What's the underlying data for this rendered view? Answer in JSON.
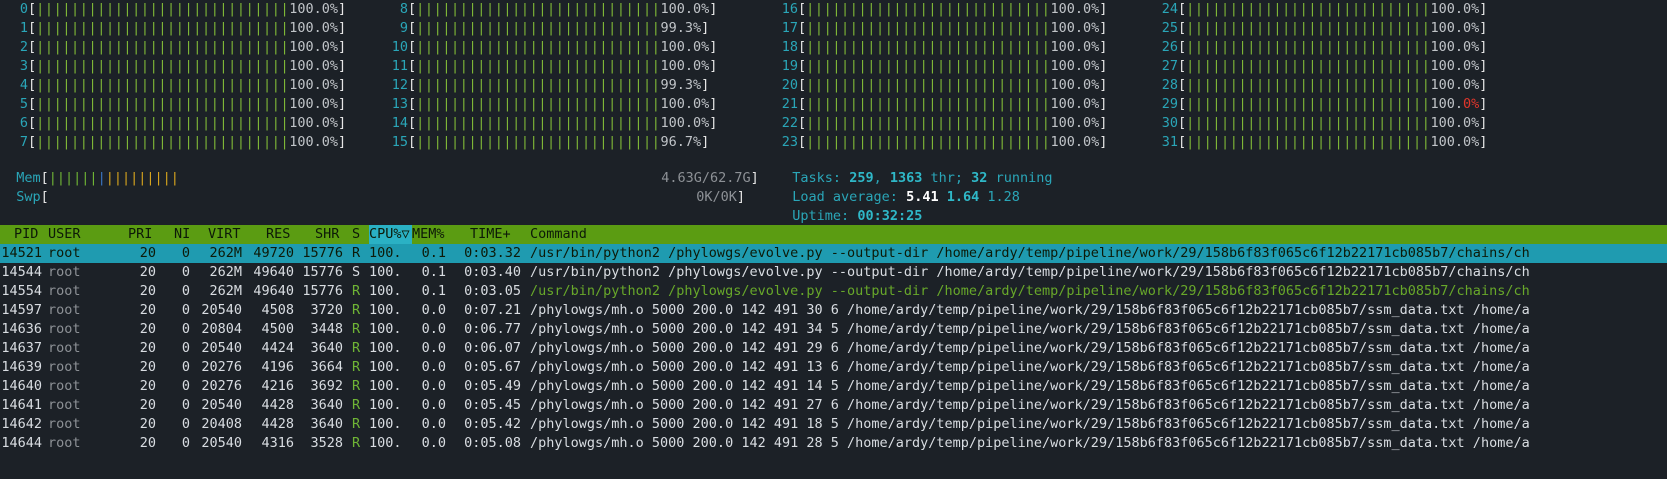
{
  "cpus": [
    {
      "id": "0",
      "bar": "|||||||||||||||||||||||||||||",
      "pct": "100.0%"
    },
    {
      "id": "1",
      "bar": "|||||||||||||||||||||||||||||",
      "pct": "100.0%"
    },
    {
      "id": "2",
      "bar": "|||||||||||||||||||||||||||||",
      "pct": "100.0%"
    },
    {
      "id": "3",
      "bar": "|||||||||||||||||||||||||||||",
      "pct": "100.0%"
    },
    {
      "id": "4",
      "bar": "|||||||||||||||||||||||||||||",
      "pct": "100.0%"
    },
    {
      "id": "5",
      "bar": "|||||||||||||||||||||||||||||",
      "pct": "100.0%"
    },
    {
      "id": "6",
      "bar": "|||||||||||||||||||||||||||||",
      "pct": "100.0%"
    },
    {
      "id": "7",
      "bar": "|||||||||||||||||||||||||||||",
      "pct": "100.0%"
    },
    {
      "id": "8",
      "bar": "||||||||||||||||||||||||||||",
      "pct": "100.0%"
    },
    {
      "id": "9",
      "bar": "||||||||||||||||||||||||||||",
      "pct": "99.3%"
    },
    {
      "id": "10",
      "bar": "||||||||||||||||||||||||||||",
      "pct": "100.0%"
    },
    {
      "id": "11",
      "bar": "||||||||||||||||||||||||||||",
      "pct": "100.0%"
    },
    {
      "id": "12",
      "bar": "||||||||||||||||||||||||||||",
      "pct": "99.3%"
    },
    {
      "id": "13",
      "bar": "||||||||||||||||||||||||||||",
      "pct": "100.0%"
    },
    {
      "id": "14",
      "bar": "||||||||||||||||||||||||||||",
      "pct": "100.0%"
    },
    {
      "id": "15",
      "bar": "||||||||||||||||||||||||||||",
      "pct": "96.7%"
    },
    {
      "id": "16",
      "bar": "||||||||||||||||||||||||||||",
      "pct": "100.0%"
    },
    {
      "id": "17",
      "bar": "||||||||||||||||||||||||||||",
      "pct": "100.0%"
    },
    {
      "id": "18",
      "bar": "||||||||||||||||||||||||||||",
      "pct": "100.0%"
    },
    {
      "id": "19",
      "bar": "||||||||||||||||||||||||||||",
      "pct": "100.0%"
    },
    {
      "id": "20",
      "bar": "||||||||||||||||||||||||||||",
      "pct": "100.0%"
    },
    {
      "id": "21",
      "bar": "||||||||||||||||||||||||||||",
      "pct": "100.0%"
    },
    {
      "id": "22",
      "bar": "||||||||||||||||||||||||||||",
      "pct": "100.0%"
    },
    {
      "id": "23",
      "bar": "||||||||||||||||||||||||||||",
      "pct": "100.0%"
    },
    {
      "id": "24",
      "bar": "||||||||||||||||||||||||||||",
      "pct": "100.0%"
    },
    {
      "id": "25",
      "bar": "||||||||||||||||||||||||||||",
      "pct": "100.0%"
    },
    {
      "id": "26",
      "bar": "||||||||||||||||||||||||||||",
      "pct": "100.0%"
    },
    {
      "id": "27",
      "bar": "||||||||||||||||||||||||||||",
      "pct": "100.0%"
    },
    {
      "id": "28",
      "bar": "||||||||||||||||||||||||||||",
      "pct": "100.0%"
    },
    {
      "id": "29",
      "bar": "||||||||||||||||||||||||||||",
      "pct": "100.0%"
    },
    {
      "id": "30",
      "bar": "||||||||||||||||||||||||||||",
      "pct": "100.0%"
    },
    {
      "id": "31",
      "bar": "||||||||||||||||||||||||||||",
      "pct": "100.0%"
    }
  ],
  "memory": {
    "mem_label": "Mem",
    "mem_bar_green": "||||||",
    "mem_bar_blue": "|",
    "mem_bar_yellow": "|||||||||",
    "mem_value": "4.63G/62.7G",
    "swp_label": "Swp",
    "swp_value": "0K/0K"
  },
  "info": {
    "tasks_label": "Tasks:",
    "tasks_count": "259",
    "tasks_sep1": ",",
    "threads_count": "1363",
    "threads_label": "thr;",
    "running_count": "32",
    "running_label": "running",
    "load_label": "Load average:",
    "load1": "5.41",
    "load5": "1.64",
    "load15": "1.28",
    "uptime_label": "Uptime:",
    "uptime_value": "00:32:25"
  },
  "columns": {
    "pid": "PID",
    "user": "USER",
    "pri": "PRI",
    "ni": "NI",
    "virt": "VIRT",
    "res": "RES",
    "shr": "SHR",
    "s": "S",
    "cpu": "CPU%▽",
    "mem": "MEM%",
    "time": "TIME+",
    "command": "Command"
  },
  "processes": [
    {
      "pid": "14521",
      "user": "root",
      "pri": "20",
      "ni": "0",
      "virt": "262M",
      "res": "49720",
      "shr": "15776",
      "s": "R",
      "cpu": "100.",
      "mem": "0.1",
      "time": "0:03.32",
      "command": "/usr/bin/python2 /phylowgs/evolve.py --output-dir /home/ardy/temp/pipeline/work/29/158b6f83f065c6f12b22171cb085b7/chains/ch",
      "selected": true,
      "thread": false
    },
    {
      "pid": "14544",
      "user": "root",
      "pri": "20",
      "ni": "0",
      "virt": "262M",
      "res": "49640",
      "shr": "15776",
      "s": "S",
      "cpu": "100.",
      "mem": "0.1",
      "time": "0:03.40",
      "command": "/usr/bin/python2 /phylowgs/evolve.py --output-dir /home/ardy/temp/pipeline/work/29/158b6f83f065c6f12b22171cb085b7/chains/ch",
      "selected": false,
      "thread": false
    },
    {
      "pid": "14554",
      "user": "root",
      "pri": "20",
      "ni": "0",
      "virt": "262M",
      "res": "49640",
      "shr": "15776",
      "s": "R",
      "cpu": "100.",
      "mem": "0.1",
      "time": "0:03.05",
      "command": "/usr/bin/python2 /phylowgs/evolve.py --output-dir /home/ardy/temp/pipeline/work/29/158b6f83f065c6f12b22171cb085b7/chains/ch",
      "selected": false,
      "thread": true
    },
    {
      "pid": "14597",
      "user": "root",
      "pri": "20",
      "ni": "0",
      "virt": "20540",
      "res": "4508",
      "shr": "3720",
      "s": "R",
      "cpu": "100.",
      "mem": "0.0",
      "time": "0:07.21",
      "command": "/phylowgs/mh.o 5000 200.0 142 491 30 6 /home/ardy/temp/pipeline/work/29/158b6f83f065c6f12b22171cb085b7/ssm_data.txt /home/a",
      "selected": false,
      "thread": false
    },
    {
      "pid": "14636",
      "user": "root",
      "pri": "20",
      "ni": "0",
      "virt": "20804",
      "res": "4500",
      "shr": "3448",
      "s": "R",
      "cpu": "100.",
      "mem": "0.0",
      "time": "0:06.77",
      "command": "/phylowgs/mh.o 5000 200.0 142 491 34 5 /home/ardy/temp/pipeline/work/29/158b6f83f065c6f12b22171cb085b7/ssm_data.txt /home/a",
      "selected": false,
      "thread": false
    },
    {
      "pid": "14637",
      "user": "root",
      "pri": "20",
      "ni": "0",
      "virt": "20540",
      "res": "4424",
      "shr": "3640",
      "s": "R",
      "cpu": "100.",
      "mem": "0.0",
      "time": "0:06.07",
      "command": "/phylowgs/mh.o 5000 200.0 142 491 29 6 /home/ardy/temp/pipeline/work/29/158b6f83f065c6f12b22171cb085b7/ssm_data.txt /home/a",
      "selected": false,
      "thread": false
    },
    {
      "pid": "14639",
      "user": "root",
      "pri": "20",
      "ni": "0",
      "virt": "20276",
      "res": "4196",
      "shr": "3664",
      "s": "R",
      "cpu": "100.",
      "mem": "0.0",
      "time": "0:05.67",
      "command": "/phylowgs/mh.o 5000 200.0 142 491 13 6 /home/ardy/temp/pipeline/work/29/158b6f83f065c6f12b22171cb085b7/ssm_data.txt /home/a",
      "selected": false,
      "thread": false
    },
    {
      "pid": "14640",
      "user": "root",
      "pri": "20",
      "ni": "0",
      "virt": "20276",
      "res": "4216",
      "shr": "3692",
      "s": "R",
      "cpu": "100.",
      "mem": "0.0",
      "time": "0:05.49",
      "command": "/phylowgs/mh.o 5000 200.0 142 491 14 5 /home/ardy/temp/pipeline/work/29/158b6f83f065c6f12b22171cb085b7/ssm_data.txt /home/a",
      "selected": false,
      "thread": false
    },
    {
      "pid": "14641",
      "user": "root",
      "pri": "20",
      "ni": "0",
      "virt": "20540",
      "res": "4428",
      "shr": "3640",
      "s": "R",
      "cpu": "100.",
      "mem": "0.0",
      "time": "0:05.45",
      "command": "/phylowgs/mh.o 5000 200.0 142 491 27 6 /home/ardy/temp/pipeline/work/29/158b6f83f065c6f12b22171cb085b7/ssm_data.txt /home/a",
      "selected": false,
      "thread": false
    },
    {
      "pid": "14642",
      "user": "root",
      "pri": "20",
      "ni": "0",
      "virt": "20408",
      "res": "4428",
      "shr": "3640",
      "s": "R",
      "cpu": "100.",
      "mem": "0.0",
      "time": "0:05.42",
      "command": "/phylowgs/mh.o 5000 200.0 142 491 18 5 /home/ardy/temp/pipeline/work/29/158b6f83f065c6f12b22171cb085b7/ssm_data.txt /home/a",
      "selected": false,
      "thread": false
    },
    {
      "pid": "14644",
      "user": "root",
      "pri": "20",
      "ni": "0",
      "virt": "20540",
      "res": "4316",
      "shr": "3528",
      "s": "R",
      "cpu": "100.",
      "mem": "0.0",
      "time": "0:05.08",
      "command": "/phylowgs/mh.o 5000 200.0 142 491 28 5 /home/ardy/temp/pipeline/work/29/158b6f83f065c6f12b22171cb085b7/ssm_data.txt /home/a",
      "selected": false,
      "thread": false
    }
  ],
  "colors": {
    "background": "#1c2127",
    "header_bg": "#5b9c12",
    "selected_bg": "#1f9bb0",
    "bar_green": "#7eb637",
    "accent_cyan": "#2aa6b8",
    "alert_red": "#e0362b"
  }
}
